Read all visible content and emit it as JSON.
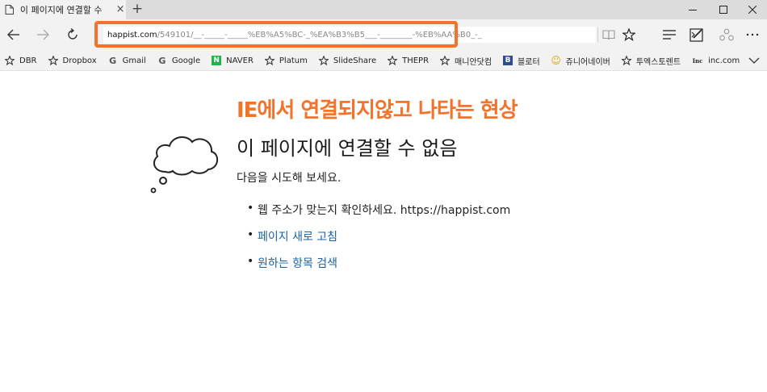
{
  "tab": {
    "title": "이 페이지에 연결할 수",
    "close": "×",
    "new_tab": "+"
  },
  "address": {
    "domain": "happist.com",
    "path": "/549101/__-_____-_____%EB%A5%BC-_%EA%B3%B5___-________-%EB%AA%B0_-_"
  },
  "favorites": [
    {
      "label": "DBR",
      "icon": "star-icon"
    },
    {
      "label": "Dropbox",
      "icon": "star-icon"
    },
    {
      "label": "Gmail",
      "icon": "google-icon",
      "glyph": "G"
    },
    {
      "label": "Google",
      "icon": "google-icon",
      "glyph": "G"
    },
    {
      "label": "NAVER",
      "icon": "naver-icon",
      "glyph": "N"
    },
    {
      "label": "Platum",
      "icon": "star-icon"
    },
    {
      "label": "SlideShare",
      "icon": "star-icon"
    },
    {
      "label": "THEPR",
      "icon": "star-icon"
    },
    {
      "label": "매니안닷컴",
      "icon": "star-icon"
    },
    {
      "label": "블로터",
      "icon": "bloter-icon",
      "glyph": "B"
    },
    {
      "label": "쥬니어네이버",
      "icon": "smiley-icon",
      "glyph": "☺"
    },
    {
      "label": "투엑스토렌트",
      "icon": "star-icon"
    },
    {
      "label": "inc.com",
      "icon": "inc-icon",
      "glyph": "Inc"
    }
  ],
  "page": {
    "title": "IE에서 연결되지않고 나타는 현상",
    "heading": "이 페이지에 연결할 수 없음",
    "suggest": "다음을 시도해 보세요.",
    "tips": {
      "check_text": "웹 주소가 맞는지 확인하세요. https://happist.com",
      "refresh": "페이지 새로 고침",
      "search": "원하는 항목 검색"
    }
  },
  "colors": {
    "accent": "#f2732b",
    "link": "#1a62a8"
  }
}
